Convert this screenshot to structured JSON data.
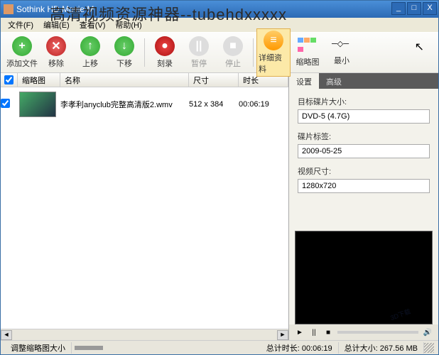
{
  "titlebar": {
    "app_title": "Sothink HD Movie M",
    "overlay": "高清视频资源神器--tubehdxxxxx"
  },
  "win_buttons": {
    "min": "_",
    "max": "□",
    "close": "X"
  },
  "menu": {
    "file": "文件(F)",
    "edit": "编辑(E)",
    "view": "查看(V)",
    "help": "帮助(H)"
  },
  "toolbar": {
    "add": "添加文件",
    "remove": "移除",
    "up": "上移",
    "down": "下移",
    "record": "刻录",
    "pause": "暂停",
    "stop": "停止",
    "detail": "详细资料",
    "thumb": "缩略图",
    "min": "最小"
  },
  "list": {
    "headers": {
      "thumb": "缩略图",
      "name": "名称",
      "size": "尺寸",
      "duration": "时长"
    },
    "rows": [
      {
        "name": "李孝利anyclub完整高清版2.wmv",
        "size": "512 x 384",
        "duration": "00:06:19"
      }
    ]
  },
  "panel": {
    "tabs": {
      "settings": "设置",
      "advanced": "高级"
    },
    "target_label": "目标碟片大小:",
    "target_value": "DVD-5 (4.7G)",
    "disc_label_label": "碟片标签:",
    "disc_label_value": "2009-05-25",
    "video_size_label": "视频尺寸:",
    "video_size_value": "1280x720"
  },
  "player": {
    "play": "►",
    "pause": "||",
    "stop": "■"
  },
  "status": {
    "resize_thumb": "调整缩略图大小",
    "total_time_label": "总计时长:",
    "total_time": "00:06:19",
    "total_size_label": "总计大小:",
    "total_size": "267.56 MB",
    "brand": "3D下载"
  }
}
